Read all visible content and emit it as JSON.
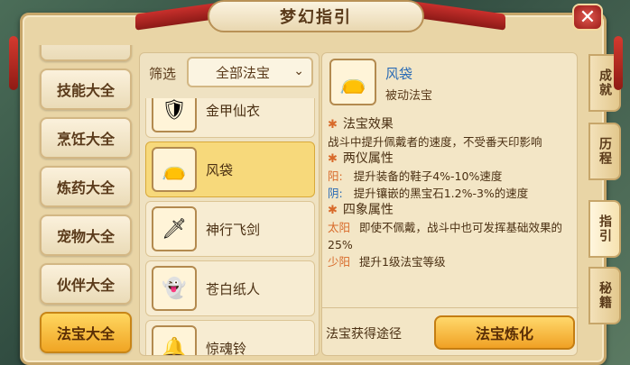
{
  "window": {
    "title": "梦幻指引",
    "close_label": "✕"
  },
  "categories": [
    {
      "label": "技能大全"
    },
    {
      "label": "烹饪大全"
    },
    {
      "label": "炼药大全"
    },
    {
      "label": "宠物大全"
    },
    {
      "label": "伙伴大全"
    },
    {
      "label": "法宝大全"
    }
  ],
  "filter": {
    "label": "筛选",
    "selected": "全部法宝"
  },
  "items": [
    {
      "name": "金甲仙衣",
      "icon": "armor-icon"
    },
    {
      "name": "风袋",
      "icon": "wind-bag-icon"
    },
    {
      "name": "神行飞剑",
      "icon": "sword-icon"
    },
    {
      "name": "苍白纸人",
      "icon": "paper-doll-icon"
    },
    {
      "name": "惊魂铃",
      "icon": "bell-icon"
    }
  ],
  "detail": {
    "name": "风袋",
    "type": "被动法宝",
    "effect_title": "法宝效果",
    "effect_text": "战斗中提升佩戴者的速度，不受番天印影响",
    "liangyi_title": "两仪属性",
    "yang_label": "阳:",
    "yang_text": "提升装备的鞋子4%-10%速度",
    "yin_label": "阴:",
    "yin_text": "提升镶嵌的黑宝石1.2%-3%的速度",
    "sixiang_title": "四象属性",
    "taiyang_label": "太阳",
    "taiyang_text": "即使不佩戴，战斗中也可发挥基础效果的25%",
    "shaoyang_label": "少阳",
    "shaoyang_text": "提升1级法宝等级",
    "obtain_label": "法宝获得途径",
    "refine_label": "法宝炼化"
  },
  "side_tabs": [
    {
      "label": "成就"
    },
    {
      "label": "历程"
    },
    {
      "label": "指引"
    },
    {
      "label": "秘籍"
    }
  ],
  "colors": {
    "accent": "#f0a524",
    "panel": "#e9d5a6",
    "link": "#2a6bb5"
  }
}
